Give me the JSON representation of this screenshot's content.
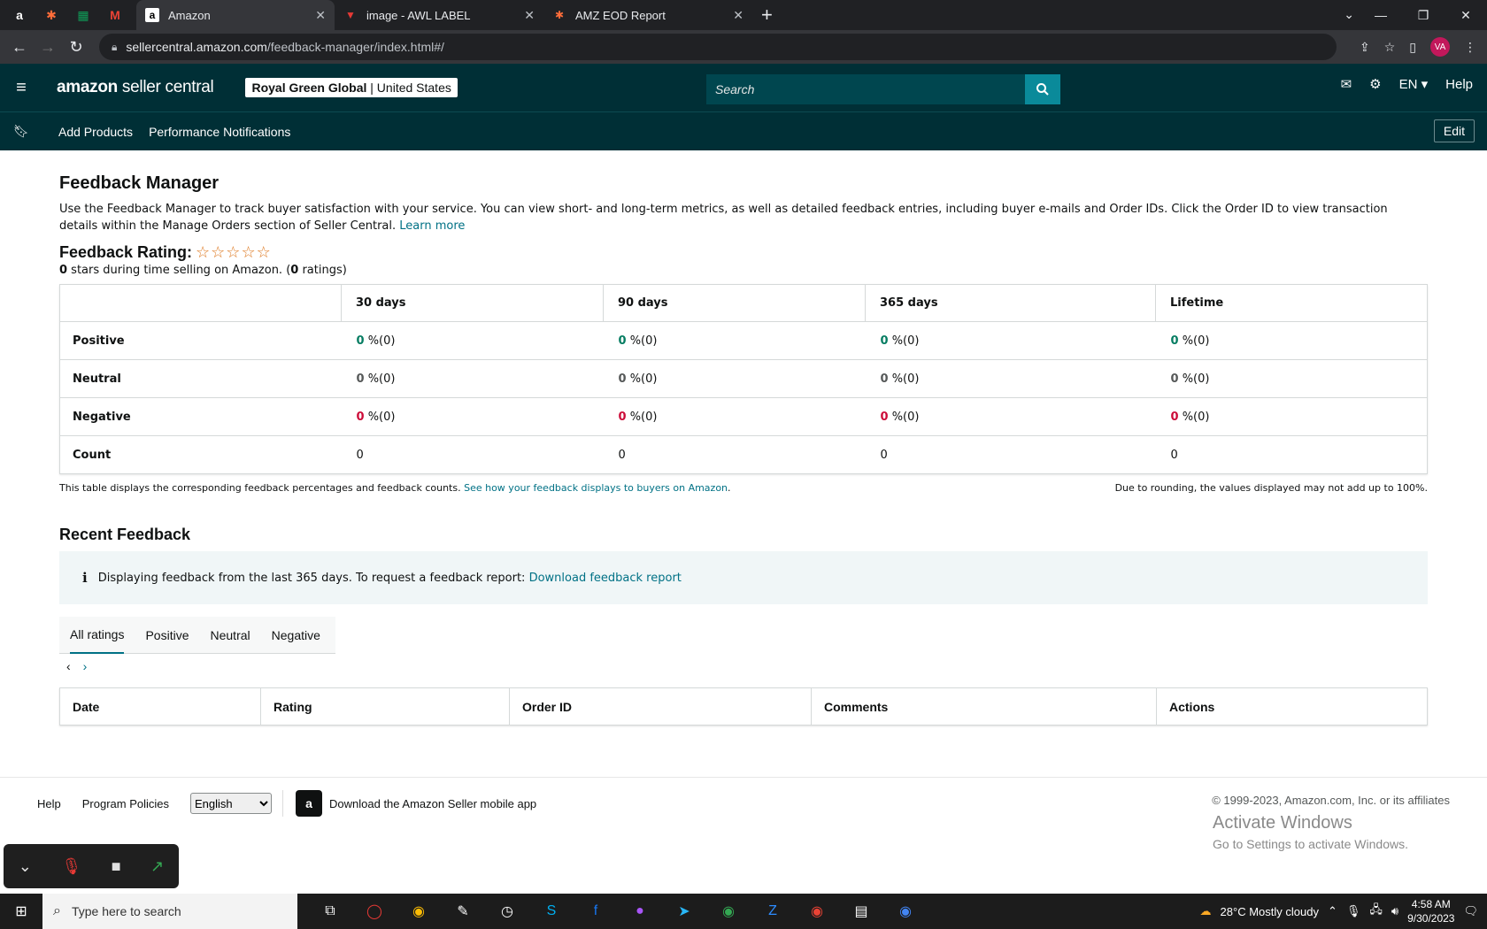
{
  "browser": {
    "tabs": [
      {
        "title": "Amazon",
        "icon": "amazon-icon",
        "active": true
      },
      {
        "title": "image - AWL LABEL",
        "icon": "awl-icon",
        "active": false
      },
      {
        "title": "AMZ EOD Report",
        "icon": "zapier-icon",
        "active": false
      }
    ],
    "url_domain": "sellercentral.amazon.com",
    "url_path": "/feedback-manager/index.html#/",
    "avatar_initials": "VA"
  },
  "header": {
    "logo_bold": "amazon",
    "logo_rest": " seller central",
    "account_name": "Royal Green Global",
    "account_region": "| United States",
    "search_placeholder": "Search",
    "language": "EN",
    "help": "Help"
  },
  "subnav": {
    "links": [
      "Add Products",
      "Performance Notifications"
    ],
    "edit": "Edit"
  },
  "page": {
    "title": "Feedback Manager",
    "intro": "Use the Feedback Manager to track buyer satisfaction with your service. You can view short- and long-term metrics, as well as detailed feedback entries, including buyer e-mails and Order IDs. Click the Order ID to view transaction details within the Manage Orders section of Seller Central.",
    "learn_more": "Learn more",
    "rating_title": "Feedback Rating:",
    "stars": "☆☆☆☆☆",
    "rating_stars_value": "0",
    "rating_sub_mid": " stars during time selling on Amazon. (",
    "rating_count": "0",
    "rating_sub_end": " ratings)"
  },
  "metrics": {
    "columns": [
      "30 days",
      "90 days",
      "365 days",
      "Lifetime"
    ],
    "rows": [
      {
        "label": "Positive",
        "values": [
          "0",
          "0",
          "0",
          "0"
        ],
        "counts": [
          "%(0)",
          "%(0)",
          "%(0)",
          "%(0)"
        ]
      },
      {
        "label": "Neutral",
        "values": [
          "0",
          "0",
          "0",
          "0"
        ],
        "counts": [
          "%(0)",
          "%(0)",
          "%(0)",
          "%(0)"
        ]
      },
      {
        "label": "Negative",
        "values": [
          "0",
          "0",
          "0",
          "0"
        ],
        "counts": [
          "%(0)",
          "%(0)",
          "%(0)",
          "%(0)"
        ]
      },
      {
        "label": "Count",
        "values": [
          "0",
          "0",
          "0",
          "0"
        ]
      }
    ],
    "note_left": "This table displays the corresponding feedback percentages and feedback counts.",
    "note_link": "See how your feedback displays to buyers on Amazon",
    "note_right": "Due to rounding, the values displayed may not add up to 100%."
  },
  "recent": {
    "title": "Recent Feedback",
    "info_text": "Displaying feedback from the last 365 days. To request a feedback report:",
    "info_link": "Download feedback report",
    "tabs": [
      "All ratings",
      "Positive",
      "Neutral",
      "Negative"
    ],
    "columns": [
      "Date",
      "Rating",
      "Order ID",
      "Comments",
      "Actions"
    ]
  },
  "footer": {
    "help": "Help",
    "policies": "Program Policies",
    "language": "English",
    "app_text": "Download the Amazon Seller mobile app",
    "copyright": "© 1999-2023, Amazon.com, Inc. or its affiliates",
    "activate_title": "Activate Windows",
    "activate_sub": "Go to Settings to activate Windows."
  },
  "taskbar": {
    "search_placeholder": "Type here to search",
    "weather": "28°C  Mostly cloudy",
    "time": "4:58 AM",
    "date": "9/30/2023"
  }
}
